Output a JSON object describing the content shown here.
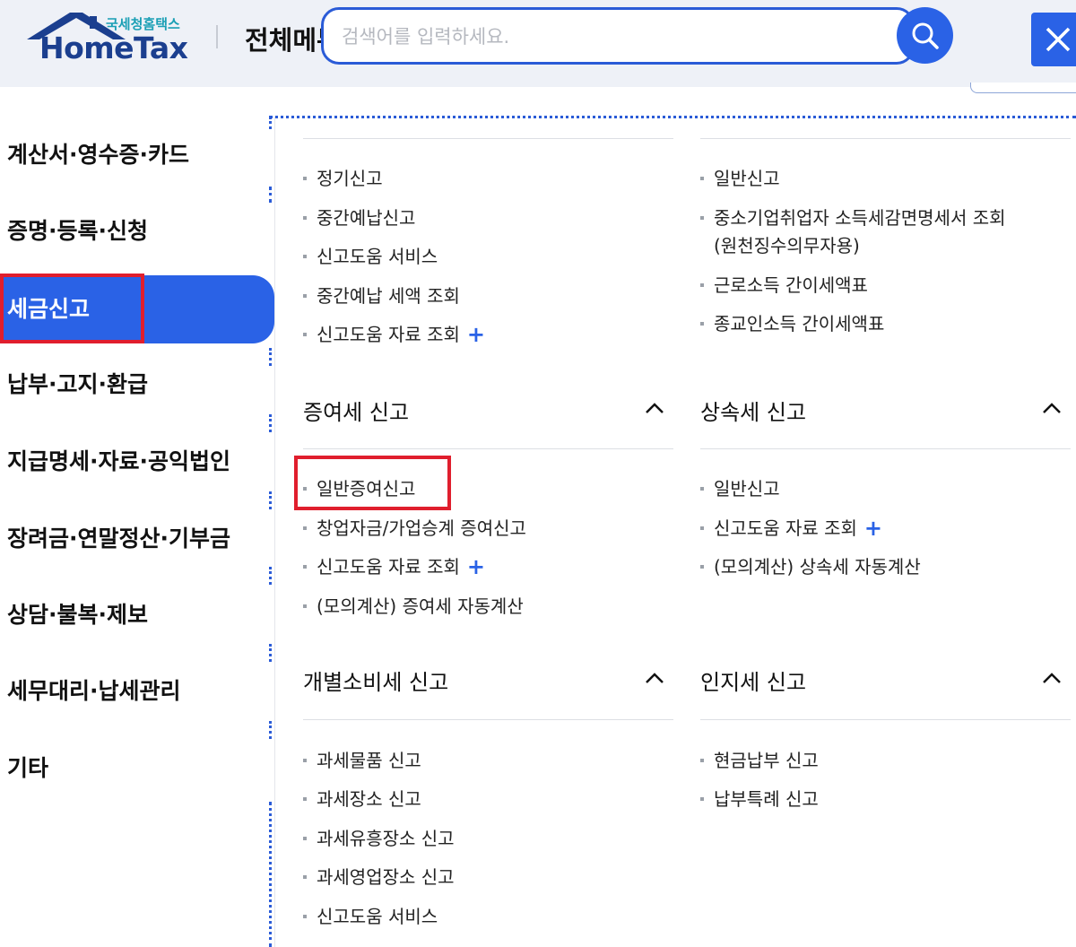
{
  "header": {
    "logo_sub": "국세청홈택스",
    "logo_main": "HomeTax",
    "menu_title": "전체메뉴",
    "search_placeholder": "검색어를 입력하세요."
  },
  "sidebar": {
    "items": [
      {
        "label": "계산서·영수증·카드"
      },
      {
        "label": "증명·등록·신청"
      },
      {
        "label": "세금신고",
        "active": true
      },
      {
        "label": "납부·고지·환급"
      },
      {
        "label": "지급명세·자료·공익법인"
      },
      {
        "label": "장려금·연말정산·기부금"
      },
      {
        "label": "상담·불복·제보"
      },
      {
        "label": "세무대리·납세관리"
      },
      {
        "label": "기타"
      }
    ]
  },
  "content": {
    "top_left_links": [
      "정기신고",
      "중간예납신고",
      "신고도움 서비스",
      "중간예납 세액 조회",
      "신고도움 자료 조회"
    ],
    "top_right_links": [
      "일반신고",
      "중소기업취업자 소득세감면명세서 조회",
      "(원천징수의무자용)",
      "근로소득 간이세액표",
      "종교인소득 간이세액표"
    ],
    "gift_tax": {
      "title": "증여세 신고",
      "links": [
        "일반증여신고",
        "창업자금/가업승계 증여신고",
        "신고도움 자료 조회",
        "(모의계산) 증여세 자동계산"
      ]
    },
    "inheritance_tax": {
      "title": "상속세 신고",
      "links": [
        "일반신고",
        "신고도움 자료 조회",
        "(모의계산) 상속세 자동계산"
      ]
    },
    "excise_tax": {
      "title": "개별소비세 신고",
      "links": [
        "과세물품 신고",
        "과세장소 신고",
        "과세유흥장소 신고",
        "과세영업장소 신고",
        "신고도움 서비스"
      ]
    },
    "stamp_tax": {
      "title": "인지세 신고",
      "links": [
        "현금납부 신고",
        "납부특례 신고"
      ]
    }
  },
  "colors": {
    "accent": "#2a62e6",
    "highlight": "#e01e2d"
  }
}
